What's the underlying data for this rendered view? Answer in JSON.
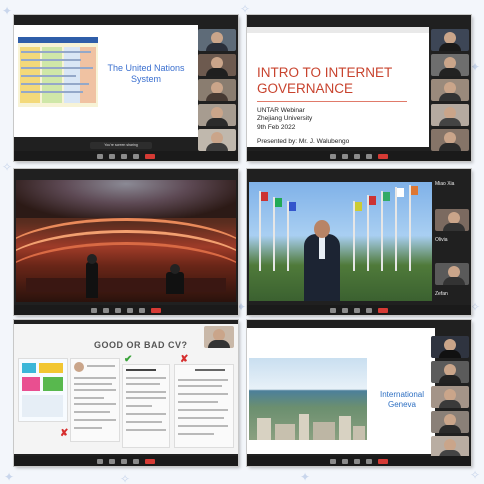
{
  "panels": {
    "un_system": {
      "chart_title": "The United Nations System",
      "slide_title": "The United Nations System",
      "share_notice": "You're screen sharing"
    },
    "intro": {
      "title_line1": "INTRO TO INTERNET",
      "title_line2": "GOVERNANCE",
      "sub1": "UNTAR Webinar",
      "sub2": "Zhejiang University",
      "sub3": "9th Feb 2022",
      "presenter": "Presented by: Mr. J. Walubengo"
    },
    "geneva_video": {
      "names": [
        "Miao Xia",
        "Olivia",
        "Zefan"
      ]
    },
    "cv": {
      "title": "GOOD OR BAD CV?",
      "good_mark": "✔",
      "bad_mark": "✘"
    },
    "geneva": {
      "title_line1": "International",
      "title_line2": "Geneva"
    }
  },
  "colors": {
    "accent_red": "#c8432e",
    "accent_blue": "#3a6fcf",
    "zoom_dark": "#202020"
  },
  "icons": [
    "mic-icon",
    "video-icon",
    "participants-icon",
    "chat-icon",
    "share-icon",
    "record-icon",
    "end-meeting-icon"
  ]
}
